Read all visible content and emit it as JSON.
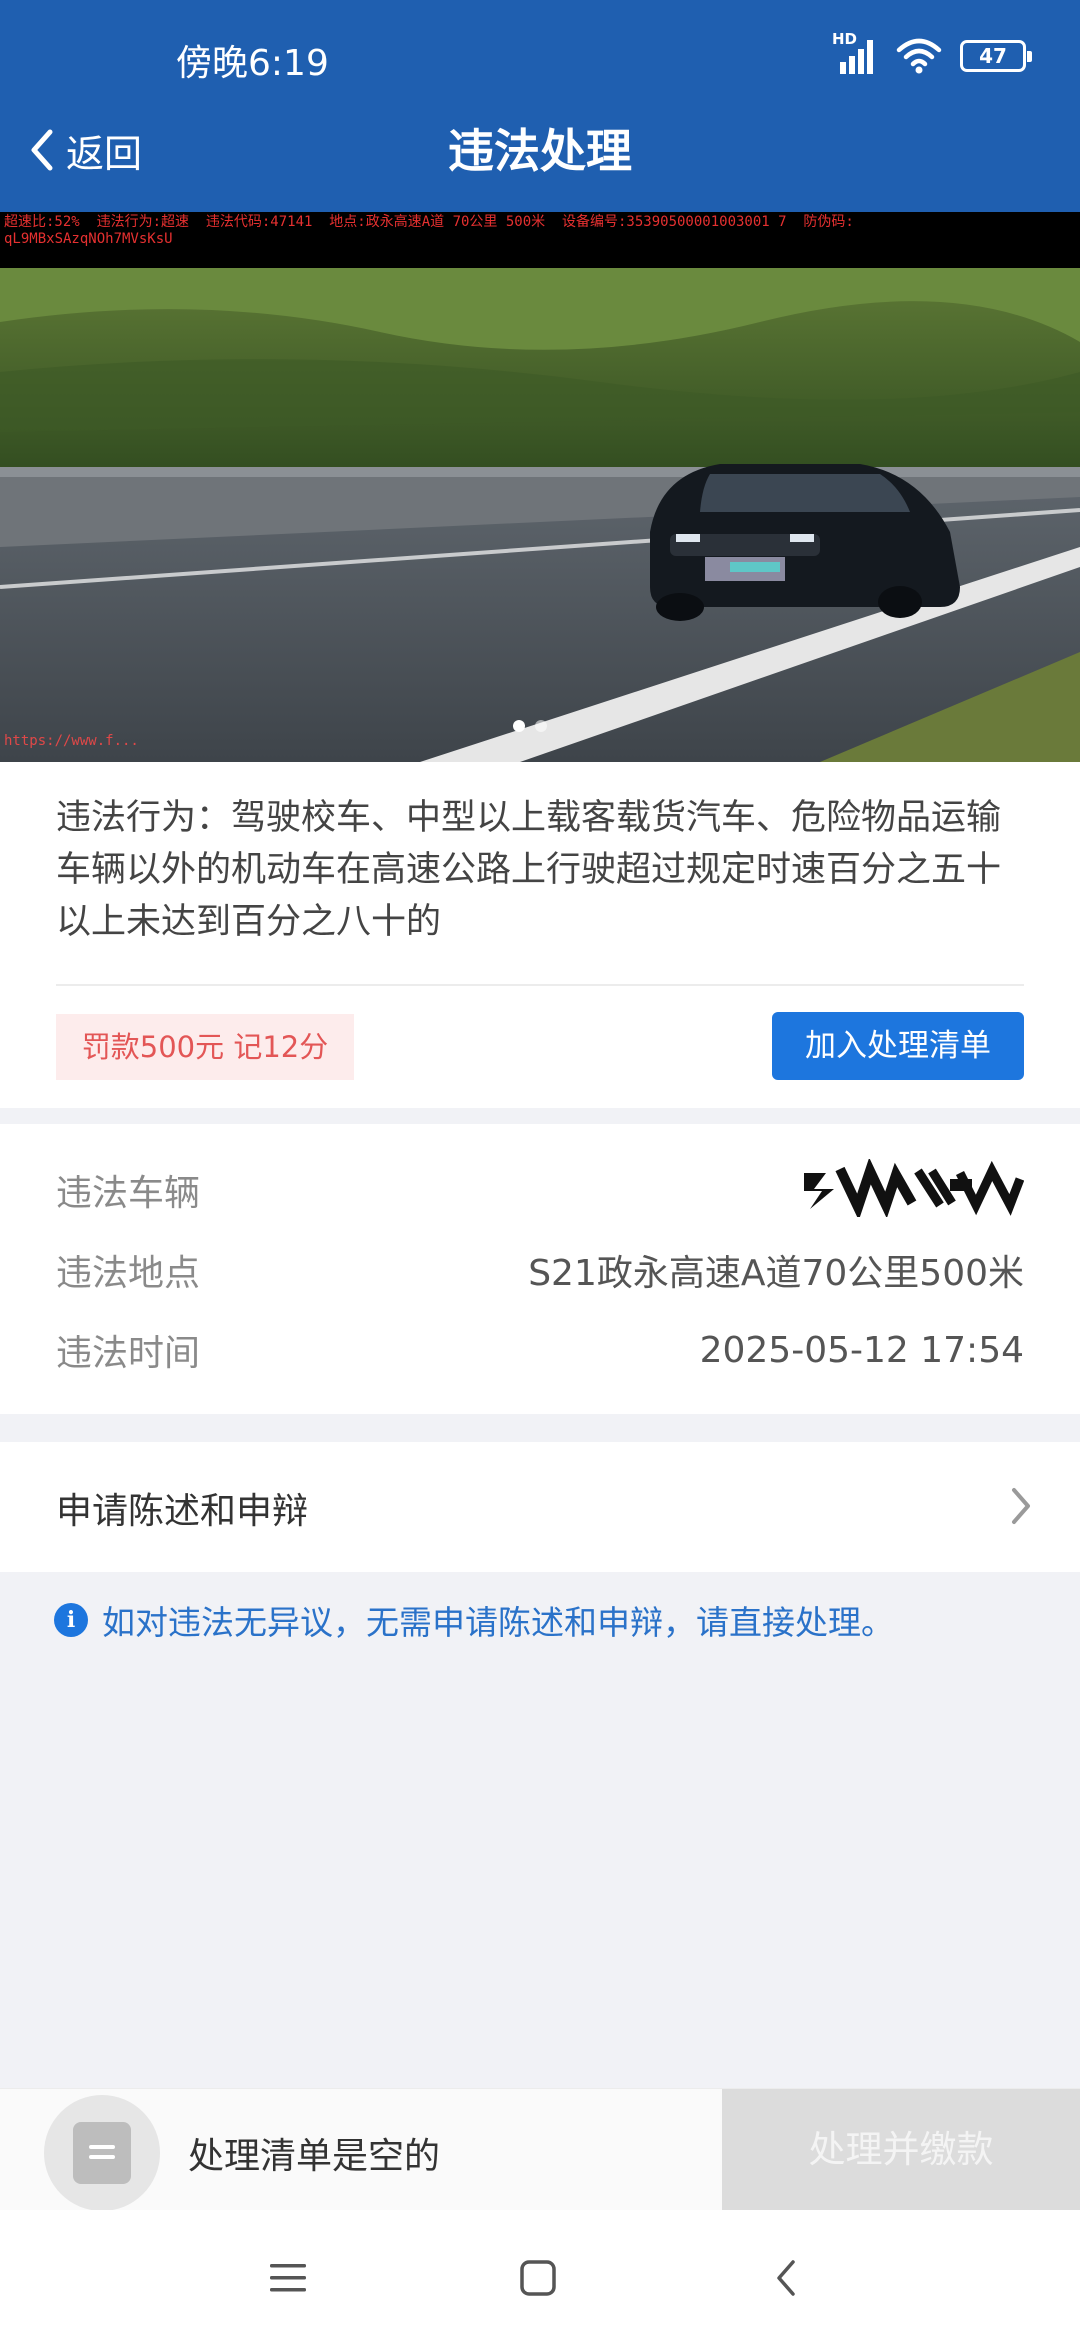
{
  "status_bar": {
    "time": "傍晚6:19",
    "network": "HD",
    "battery_level": "47"
  },
  "header": {
    "back_label": "返回",
    "title": "违法处理"
  },
  "photo": {
    "overlay_top_text": "超速比:52%  违法行为:超速  违法代码:47141  地点:政永高速A道 70公里 500米  设备编号:35390500001003001 7  防伪码:\nqL9MBxSAzqNOh7MVsKsU",
    "overlay_bottom_text": "https://www.f...",
    "page_count": 2,
    "active_page": 1
  },
  "violation": {
    "description": "违法行为：驾驶校车、中型以上载客载货汽车、危险物品运输车辆以外的机动车在高速公路上行驶超过规定时速百分之五十以上未达到百分之八十的",
    "penalty": "罚款500元 记12分",
    "add_to_list_label": "加入处理清单"
  },
  "info": {
    "vehicle_label": "违法车辆",
    "location_label": "违法地点",
    "location_value": "S21政永高速A道70公里500米",
    "time_label": "违法时间",
    "time_value": "2025-05-12 17:54"
  },
  "appeal": {
    "label": "申请陈述和申辩"
  },
  "notice": {
    "text": "如对违法无异议，无需申请陈述和申辩，请直接处理。"
  },
  "bottom_bar": {
    "empty_label": "处理清单是空的",
    "pay_label": "处理并缴款"
  },
  "colors": {
    "header_blue": "#1f5fb0",
    "primary_button": "#1d76de",
    "penalty_text": "#e35656",
    "penalty_bg": "#fdecec",
    "notice_text": "#2a72c9"
  },
  "icons": {
    "back": "chevron-left-icon",
    "appeal": "chevron-right-icon",
    "notice": "info-icon",
    "cart": "list-icon",
    "nav_menu": "menu-icon",
    "nav_home": "square-icon",
    "nav_back": "back-icon"
  }
}
